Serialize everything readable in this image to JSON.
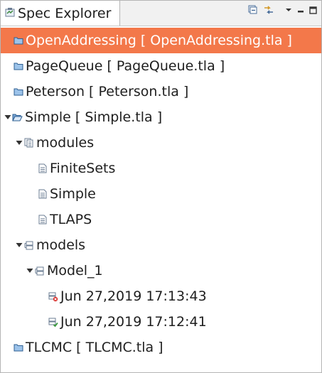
{
  "view": {
    "tab_title": "Spec Explorer",
    "toolbar": {
      "collapse_icon": "collapse-all-icon",
      "link_icon": "link-with-editor-icon",
      "menu_icon": "view-menu-chevron-icon",
      "minimize_icon": "minimize-icon",
      "maximize_icon": "maximize-icon"
    }
  },
  "colors": {
    "selection": "#f3784a",
    "selection_text": "#ffffff",
    "spec_icon": "#4a7fb8",
    "error_dot": "#d9302c",
    "ok_mark": "#3a9a3a"
  },
  "tree": {
    "items": [
      {
        "label": "OpenAddressing [ OpenAddressing.tla ]",
        "icon": "spec-icon",
        "selected": true
      },
      {
        "label": "PageQueue [ PageQueue.tla ]",
        "icon": "spec-icon"
      },
      {
        "label": "Peterson [ Peterson.tla ]",
        "icon": "spec-icon"
      },
      {
        "label": "Simple [ Simple.tla ]",
        "icon": "spec-open-icon",
        "expanded": true
      },
      {
        "label": "modules",
        "icon": "modules-icon",
        "expanded": true
      },
      {
        "label": "FiniteSets",
        "icon": "module-file-icon"
      },
      {
        "label": "Simple",
        "icon": "module-file-icon"
      },
      {
        "label": "TLAPS",
        "icon": "module-file-icon"
      },
      {
        "label": "models",
        "icon": "models-icon",
        "expanded": true
      },
      {
        "label": "Model_1",
        "icon": "model-icon",
        "expanded": true
      },
      {
        "label": "Jun 27,2019 17:13:43",
        "icon": "model-run-error-icon"
      },
      {
        "label": "Jun 27,2019 17:12:41",
        "icon": "model-run-ok-icon"
      },
      {
        "label": "TLCMC [ TLCMC.tla ]",
        "icon": "spec-icon"
      }
    ]
  }
}
